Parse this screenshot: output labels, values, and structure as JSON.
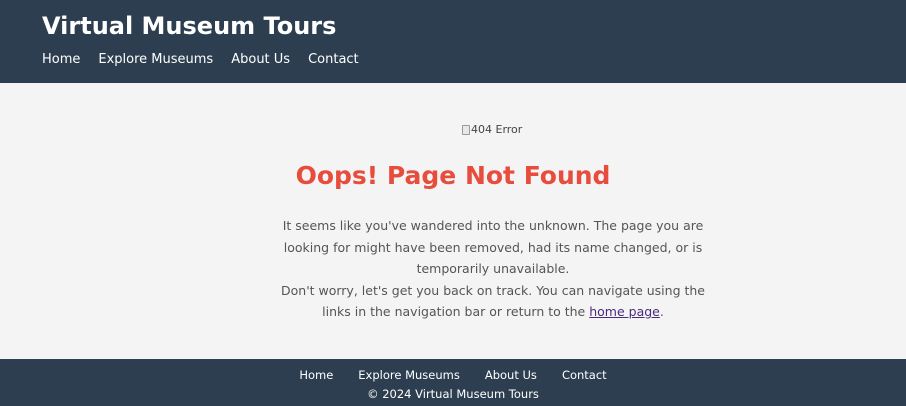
{
  "header": {
    "title": "Virtual Museum Tours",
    "nav": [
      "Home",
      "Explore Museums",
      "About Us",
      "Contact"
    ]
  },
  "main": {
    "image_alt": "404 Error",
    "heading": "Oops! Page Not Found",
    "paragraph1": "It seems like you've wandered into the unknown. The page you are looking for might have been removed, had its name changed, or is temporarily unavailable.",
    "paragraph2_prefix": "Don't worry, let's get you back on track. You can navigate using the links in the navigation bar or return to the ",
    "home_link": "home page",
    "paragraph2_suffix": "."
  },
  "footer": {
    "nav": [
      "Home",
      "Explore Museums",
      "About Us",
      "Contact"
    ],
    "copyright": "© 2024 Virtual Museum Tours"
  },
  "colors": {
    "header_bg": "#2c3e50",
    "heading": "#e74c3c",
    "page_bg": "#f4f4f4"
  }
}
